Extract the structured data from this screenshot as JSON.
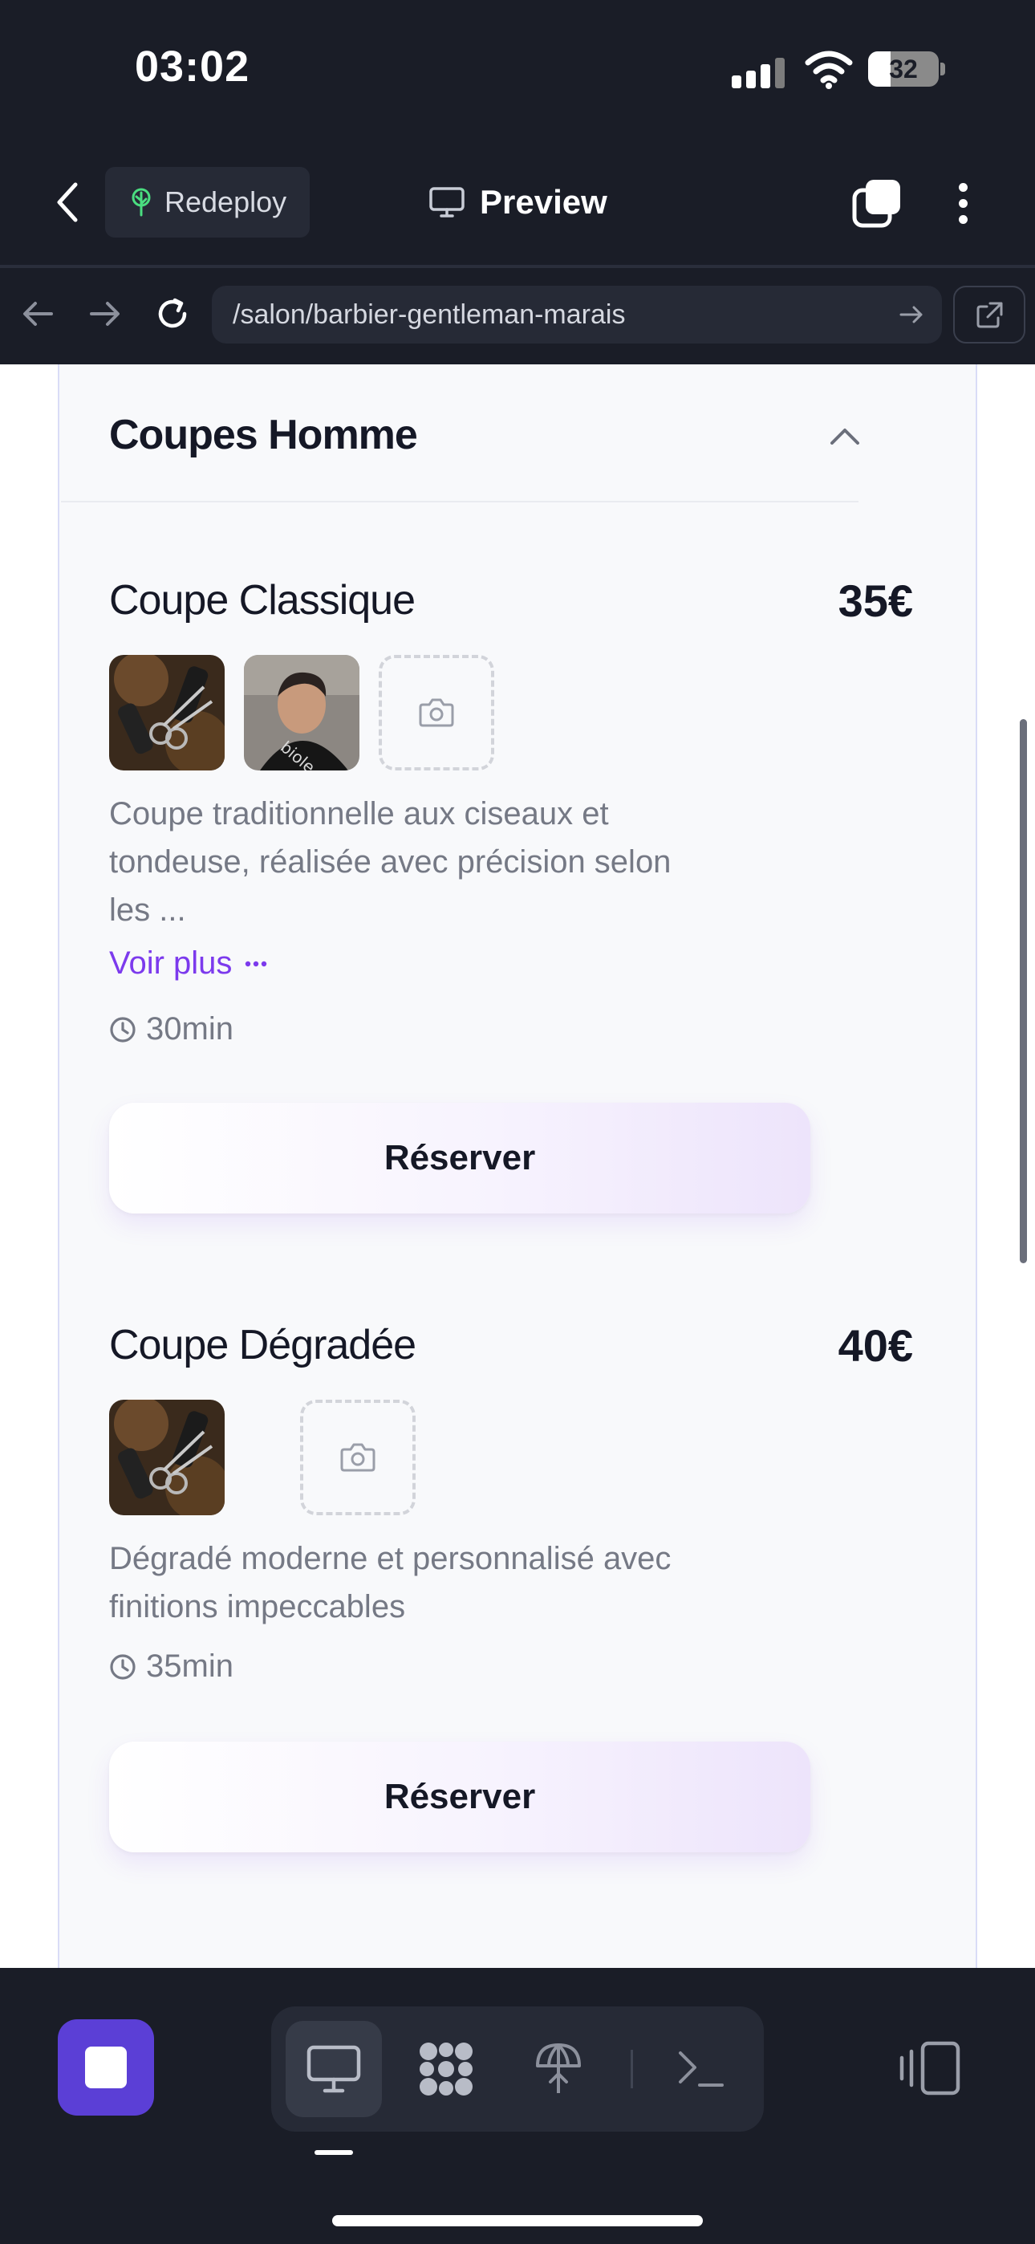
{
  "status_bar": {
    "time": "03:02",
    "battery_level": "32",
    "battery_fraction": 0.32
  },
  "toolbar": {
    "redeploy_label": "Redeploy",
    "preview_label": "Preview"
  },
  "browser": {
    "url": "/salon/barbier-gentleman-marais"
  },
  "section": {
    "title": "Coupes Homme"
  },
  "services": [
    {
      "name": "Coupe Classique",
      "price": "35€",
      "description": "Coupe traditionnelle aux ciseaux et tondeuse, réalisée avec précision selon les ...",
      "more_label": "Voir plus",
      "duration": "30min",
      "button_label": "Réserver"
    },
    {
      "name": "Coupe Dégradée",
      "price": "40€",
      "description": "Dégradé moderne et personnalisé avec finitions impeccables",
      "duration": "35min",
      "button_label": "Réserver"
    }
  ],
  "colors": {
    "accent": "#7c3aed",
    "stop_button": "#5b3fd6",
    "background": "#1a1d27"
  },
  "icons": {
    "back": "chevron-left-icon",
    "redeploy": "tree-icon",
    "preview": "monitor-icon",
    "tabs": "tabs-icon",
    "menu": "more-vertical-icon",
    "nav_back": "arrow-left-icon",
    "nav_forward": "arrow-right-icon",
    "reload": "reload-icon",
    "open_external": "external-link-icon",
    "collapse": "chevron-up-icon",
    "add_photo": "camera-icon",
    "clock": "clock-icon",
    "bottom_tabs": [
      "monitor-icon",
      "puzzle-icon",
      "deploy-icon",
      "terminal-icon"
    ]
  }
}
